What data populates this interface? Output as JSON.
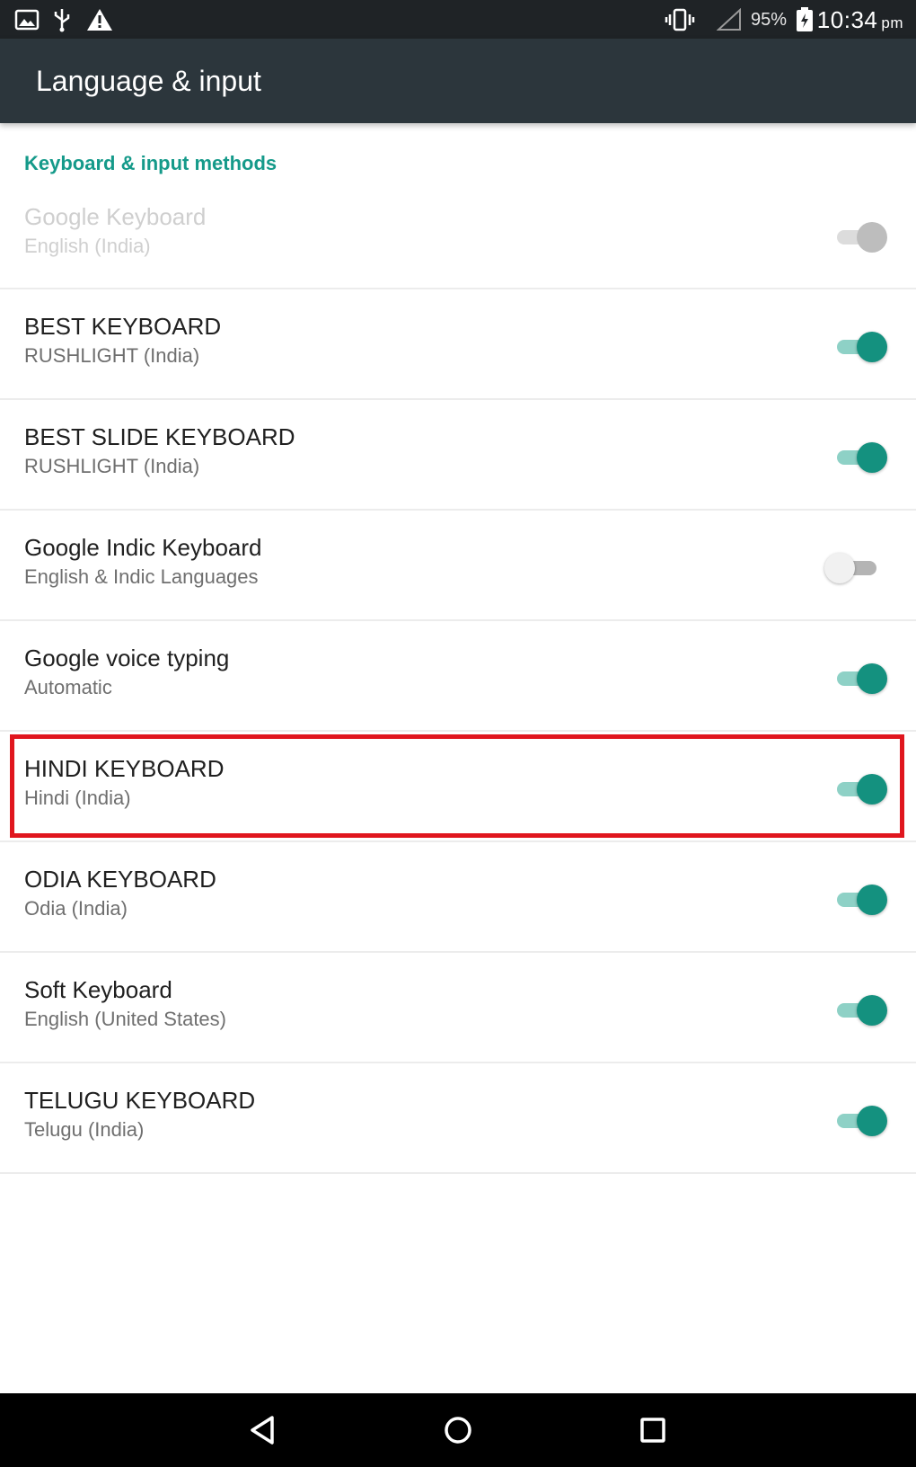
{
  "status_bar": {
    "icons": [
      "image-icon",
      "usb-icon",
      "warning-icon",
      "vibrate-icon",
      "no-signal-icon",
      "battery-charging-icon"
    ],
    "battery": "95%",
    "time": "10:34",
    "ampm": "pm"
  },
  "app_bar": {
    "title": "Language & input"
  },
  "section": {
    "header": "Keyboard & input methods"
  },
  "keyboards": [
    {
      "title": "Google Keyboard",
      "subtitle": "English (India)",
      "state": "disabled-on"
    },
    {
      "title": "BEST KEYBOARD",
      "subtitle": "RUSHLIGHT (India)",
      "state": "on"
    },
    {
      "title": "BEST SLIDE KEYBOARD",
      "subtitle": "RUSHLIGHT (India)",
      "state": "on"
    },
    {
      "title": "Google Indic Keyboard",
      "subtitle": "English & Indic Languages",
      "state": "off"
    },
    {
      "title": "Google voice typing",
      "subtitle": "Automatic",
      "state": "on"
    },
    {
      "title": "HINDI KEYBOARD",
      "subtitle": "Hindi (India)",
      "state": "on",
      "highlighted": true
    },
    {
      "title": "ODIA KEYBOARD",
      "subtitle": "Odia (India)",
      "state": "on"
    },
    {
      "title": "Soft Keyboard",
      "subtitle": "English (United States)",
      "state": "on"
    },
    {
      "title": "TELUGU KEYBOARD",
      "subtitle": "Telugu (India)",
      "state": "on"
    }
  ],
  "nav_bar": {
    "buttons": [
      "back-icon",
      "home-icon",
      "recents-icon"
    ]
  },
  "colors": {
    "accent": "#159a8a",
    "toggle_on": "#14917f",
    "app_bar": "#2c363c",
    "highlight": "#e0161e"
  }
}
